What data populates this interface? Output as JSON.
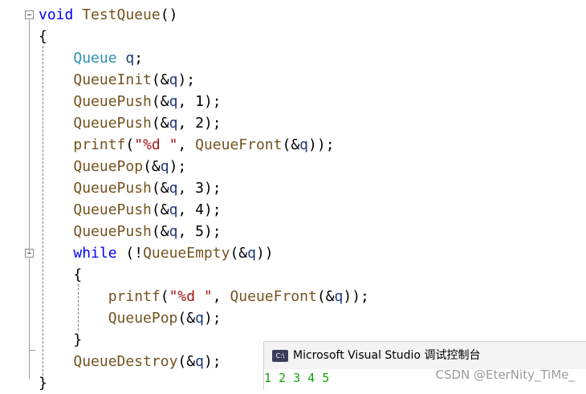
{
  "editor": {
    "lines": [
      [
        [
          "kw",
          "void"
        ],
        [
          "pn",
          " "
        ],
        [
          "fn",
          "TestQueue"
        ],
        [
          "pn",
          "()"
        ]
      ],
      [
        [
          "pn",
          "{"
        ]
      ],
      [
        [
          "pn",
          "    "
        ],
        [
          "ty",
          "Queue"
        ],
        [
          "pn",
          " "
        ],
        [
          "id",
          "q"
        ],
        [
          "pn",
          ";"
        ]
      ],
      [
        [
          "pn",
          "    "
        ],
        [
          "fn",
          "QueueInit"
        ],
        [
          "pn",
          "(&"
        ],
        [
          "id",
          "q"
        ],
        [
          "pn",
          ");"
        ]
      ],
      [
        [
          "pn",
          "    "
        ],
        [
          "fn",
          "QueuePush"
        ],
        [
          "pn",
          "(&"
        ],
        [
          "id",
          "q"
        ],
        [
          "pn",
          ", "
        ],
        [
          "num",
          "1"
        ],
        [
          "pn",
          ");"
        ]
      ],
      [
        [
          "pn",
          "    "
        ],
        [
          "fn",
          "QueuePush"
        ],
        [
          "pn",
          "(&"
        ],
        [
          "id",
          "q"
        ],
        [
          "pn",
          ", "
        ],
        [
          "num",
          "2"
        ],
        [
          "pn",
          ");"
        ]
      ],
      [
        [
          "pn",
          "    "
        ],
        [
          "fn",
          "printf"
        ],
        [
          "pn",
          "("
        ],
        [
          "str",
          "\"%d \""
        ],
        [
          "pn",
          ", "
        ],
        [
          "fn",
          "QueueFront"
        ],
        [
          "pn",
          "(&"
        ],
        [
          "id",
          "q"
        ],
        [
          "pn",
          "));"
        ]
      ],
      [
        [
          "pn",
          "    "
        ],
        [
          "fn",
          "QueuePop"
        ],
        [
          "pn",
          "(&"
        ],
        [
          "id",
          "q"
        ],
        [
          "pn",
          ");"
        ]
      ],
      [
        [
          "pn",
          "    "
        ],
        [
          "fn",
          "QueuePush"
        ],
        [
          "pn",
          "(&"
        ],
        [
          "id",
          "q"
        ],
        [
          "pn",
          ", "
        ],
        [
          "num",
          "3"
        ],
        [
          "pn",
          ");"
        ]
      ],
      [
        [
          "pn",
          "    "
        ],
        [
          "fn",
          "QueuePush"
        ],
        [
          "pn",
          "(&"
        ],
        [
          "id",
          "q"
        ],
        [
          "pn",
          ", "
        ],
        [
          "num",
          "4"
        ],
        [
          "pn",
          ");"
        ]
      ],
      [
        [
          "pn",
          "    "
        ],
        [
          "fn",
          "QueuePush"
        ],
        [
          "pn",
          "(&"
        ],
        [
          "id",
          "q"
        ],
        [
          "pn",
          ", "
        ],
        [
          "num",
          "5"
        ],
        [
          "pn",
          ");"
        ]
      ],
      [
        [
          "pn",
          "    "
        ],
        [
          "kw",
          "while"
        ],
        [
          "pn",
          " (!"
        ],
        [
          "fn",
          "QueueEmpty"
        ],
        [
          "pn",
          "(&"
        ],
        [
          "id",
          "q"
        ],
        [
          "pn",
          "))"
        ]
      ],
      [
        [
          "pn",
          "    {"
        ]
      ],
      [
        [
          "pn",
          "        "
        ],
        [
          "fn",
          "printf"
        ],
        [
          "pn",
          "("
        ],
        [
          "str",
          "\"%d \""
        ],
        [
          "pn",
          ", "
        ],
        [
          "fn",
          "QueueFront"
        ],
        [
          "pn",
          "(&"
        ],
        [
          "id",
          "q"
        ],
        [
          "pn",
          "));"
        ]
      ],
      [
        [
          "pn",
          "        "
        ],
        [
          "fn",
          "QueuePop"
        ],
        [
          "pn",
          "(&"
        ],
        [
          "id",
          "q"
        ],
        [
          "pn",
          ");"
        ]
      ],
      [
        [
          "pn",
          "    }"
        ]
      ],
      [
        [
          "pn",
          "    "
        ],
        [
          "fn",
          "QueueDestroy"
        ],
        [
          "pn",
          "(&"
        ],
        [
          "id",
          "q"
        ],
        [
          "pn",
          ");"
        ]
      ],
      [
        [
          "pn",
          "}"
        ]
      ]
    ],
    "colors": {
      "keyword": "#0000ff",
      "function": "#74531f",
      "identifier": "#1f377f",
      "type": "#2b91af",
      "string": "#a31515"
    }
  },
  "console": {
    "title": "Microsoft Visual Studio 调试控制台",
    "icon": "console-app-icon",
    "icon_text": "C:\\",
    "output": "1 2 3 4 5",
    "output_color": "#13a10e"
  },
  "watermark": "CSDN @EterNity_TiMe_"
}
